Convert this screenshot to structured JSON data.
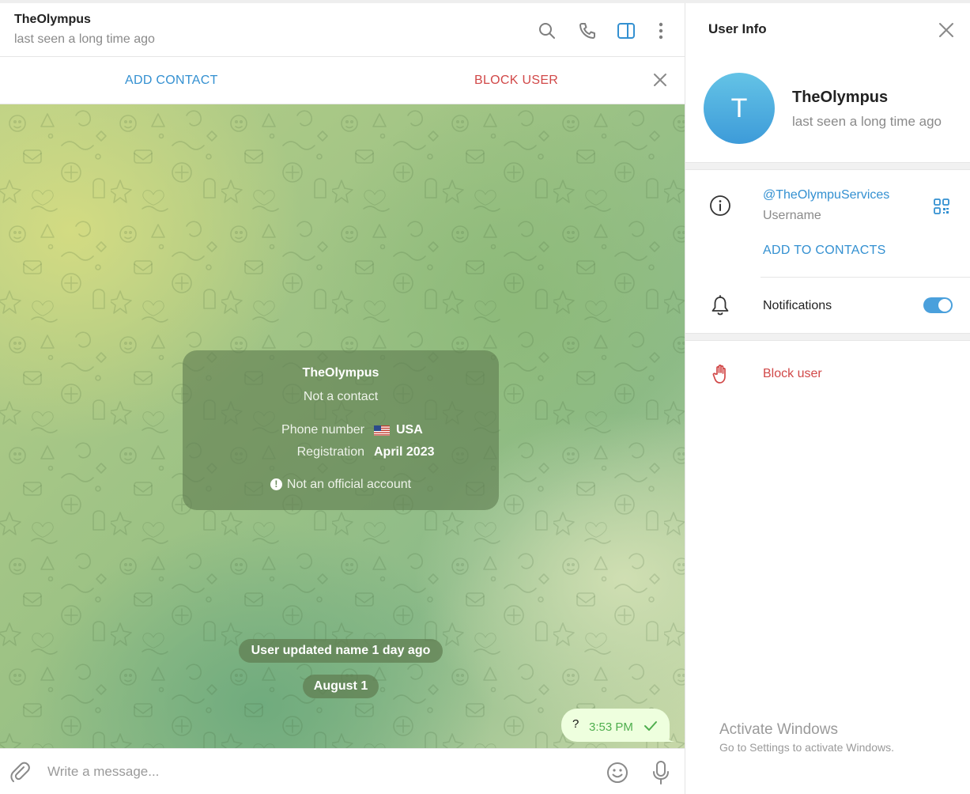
{
  "chat": {
    "title": "TheOlympus",
    "status": "last seen a long time ago",
    "header_icons": [
      "search-icon",
      "phone-icon",
      "sidebar-panel-icon",
      "more-vertical-icon"
    ],
    "action_bar": {
      "add_contact": "ADD CONTACT",
      "block_user": "BLOCK USER",
      "close_icon": "close-icon"
    },
    "info_card": {
      "name": "TheOlympus",
      "subtitle": "Not a contact",
      "phone_label": "Phone number",
      "phone_flag": "us-flag-icon",
      "phone_value": "USA",
      "registration_label": "Registration",
      "registration_value": "April 2023",
      "warning": "Not an official account"
    },
    "service_messages": [
      "User updated name 1 day ago",
      "August 1"
    ],
    "outgoing_message": {
      "text": "?",
      "time": "3:53 PM",
      "status_icon": "check-icon"
    },
    "composer": {
      "placeholder": "Write a message...",
      "icons": [
        "paperclip-icon",
        "emoji-icon",
        "microphone-icon"
      ]
    }
  },
  "info_panel": {
    "title": "User Info",
    "avatar_letter": "T",
    "name": "TheOlympus",
    "status": "last seen a long time ago",
    "username": "@TheOlympuServices",
    "username_label": "Username",
    "add_to_contacts": "ADD TO CONTACTS",
    "notifications_label": "Notifications",
    "notifications_enabled": true,
    "block_user": "Block user"
  },
  "watermark": {
    "title": "Activate Windows",
    "subtitle": "Go to Settings to activate Windows."
  },
  "colors": {
    "accent_blue": "#3390d1",
    "danger_red": "#d14848",
    "outgoing_bubble": "#eeffde",
    "time_green": "#4fae4e"
  }
}
